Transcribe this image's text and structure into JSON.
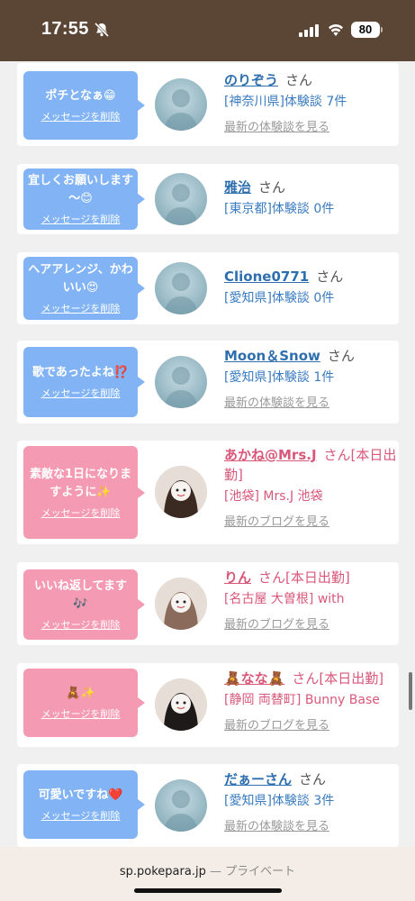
{
  "status_bar": {
    "time": "17:55",
    "battery": "80"
  },
  "url_bar": {
    "domain": "sp.pokepara.jp",
    "separator": " — ",
    "mode": "プライベート"
  },
  "delete_label": "メッセージを削除",
  "entries": [
    {
      "message": "ポチとなぁ😁",
      "name": "のりぞう",
      "honorific": "さん",
      "sub": "[神奈川県]体験談 7件",
      "link": "最新の体験談を見る",
      "style": "blue",
      "avatar": "no-photo"
    },
    {
      "message": "宜しくお願いします～😊",
      "name": "雅治",
      "honorific": "さん",
      "sub": "[東京都]体験談 0件",
      "link": "",
      "style": "blue",
      "avatar": "no-photo"
    },
    {
      "message": "ヘアアレンジ、かわいい😍",
      "name": "Clione0771",
      "honorific": "さん",
      "sub": "[愛知県]体験談 0件",
      "link": "",
      "style": "blue",
      "avatar": "no-photo"
    },
    {
      "message": "歌であったよね⁉️",
      "name": "Moon＆Snow",
      "honorific": "さん",
      "sub": "[愛知県]体験談 1件",
      "link": "最新の体験談を見る",
      "style": "blue",
      "avatar": "no-photo"
    },
    {
      "message": "素敵な1日になりますように✨",
      "name": "あかね@Mrs.J",
      "honorific": "さん[本日出勤]",
      "sub": "[池袋] Mrs.J 池袋",
      "link": "最新のブログを見る",
      "style": "pink",
      "avatar": "photo"
    },
    {
      "message": "いいね返してます🎶",
      "name": "りん",
      "honorific": "さん[本日出勤]",
      "sub": "[名古屋 大曽根] with",
      "link": "最新のブログを見る",
      "style": "pink",
      "avatar": "photo"
    },
    {
      "message": "🧸✨",
      "name": "🧸なな🧸",
      "honorific": "さん[本日出勤]",
      "sub": "[静岡 両替町] Bunny Base",
      "link": "最新のブログを見る",
      "style": "pink",
      "avatar": "photo"
    },
    {
      "message": "可愛いですね❤️",
      "name": "だぁーさん",
      "honorific": "さん",
      "sub": "[愛知県]体験談 3件",
      "link": "最新の体験談を見る",
      "style": "blue",
      "avatar": "no-photo"
    }
  ],
  "colors": {
    "status_bar_bg": "#5b4535",
    "blue_bubble": "#82b4f5",
    "pink_bubble": "#f59ab3",
    "blue_text": "#2f6fae",
    "pink_text": "#d8587a"
  }
}
